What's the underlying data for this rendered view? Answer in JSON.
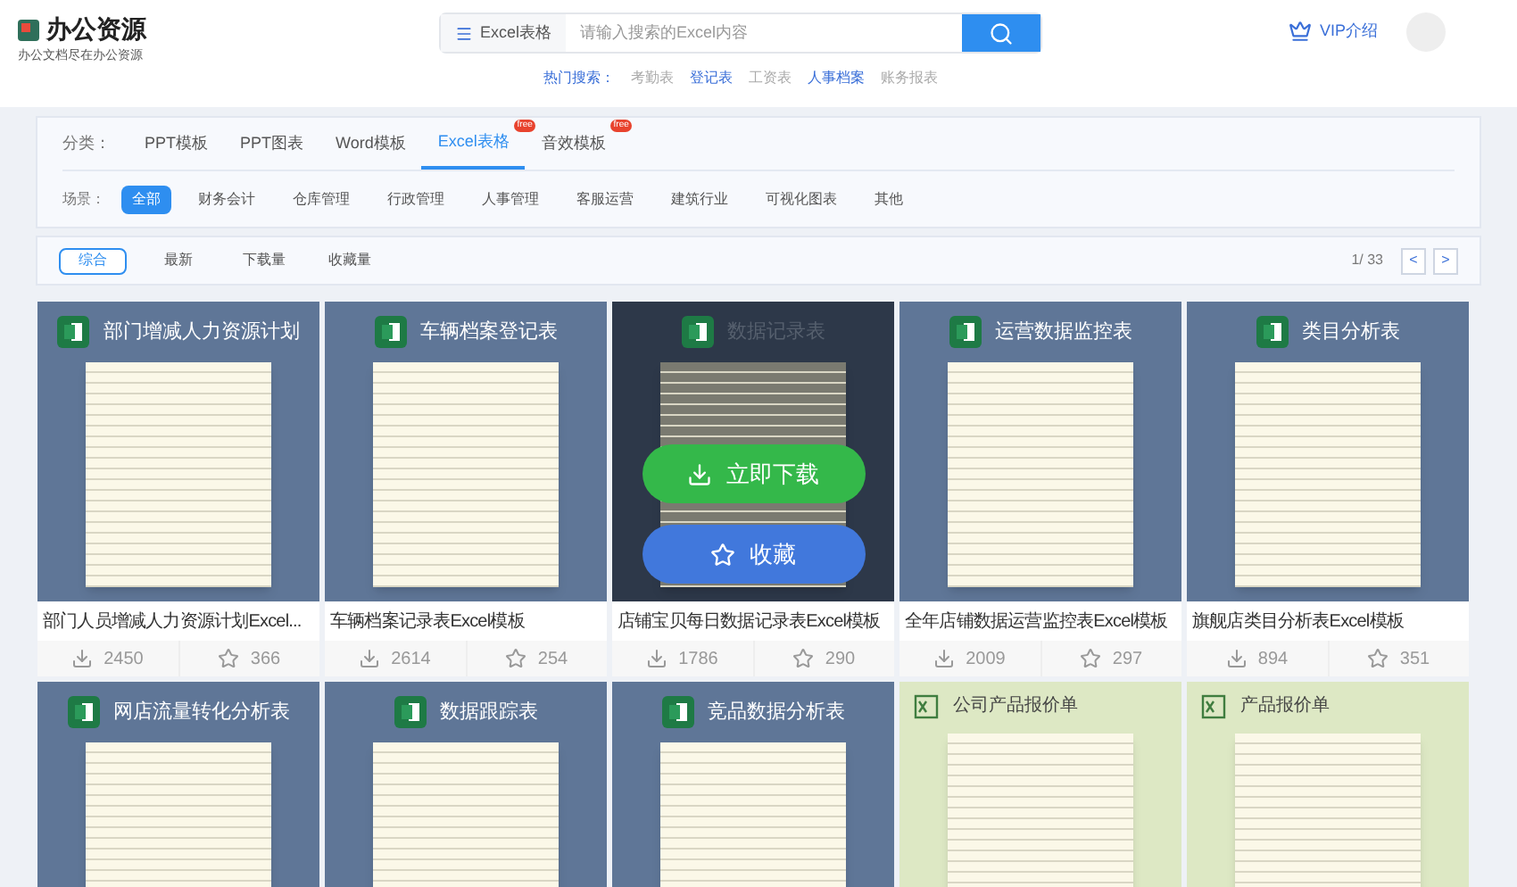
{
  "logo": {
    "name": "办公资源",
    "slogan": "办公文档尽在办公资源"
  },
  "search": {
    "category": "Excel表格",
    "placeholder": "请输入搜索的Excel内容"
  },
  "hot_searches": {
    "label": "热门搜索：",
    "items": [
      {
        "text": "考勤表",
        "highlighted": false
      },
      {
        "text": "登记表",
        "highlighted": true
      },
      {
        "text": "工资表",
        "highlighted": false
      },
      {
        "text": "人事档案",
        "highlighted": true
      },
      {
        "text": "账务报表",
        "highlighted": false
      }
    ]
  },
  "vip": {
    "label": "VIP介绍"
  },
  "categories": {
    "label": "分类：",
    "items": [
      {
        "text": "PPT模板",
        "selected": false
      },
      {
        "text": "PPT图表",
        "selected": false
      },
      {
        "text": "Word模板",
        "selected": false
      },
      {
        "text": "Excel表格",
        "selected": true,
        "badge": "free"
      },
      {
        "text": "音效模板",
        "selected": false,
        "badge": "free"
      }
    ]
  },
  "scenes": {
    "label": "场景：",
    "items": [
      {
        "text": "全部",
        "selected": true
      },
      {
        "text": "财务会计",
        "selected": false
      },
      {
        "text": "仓库管理",
        "selected": false
      },
      {
        "text": "行政管理",
        "selected": false
      },
      {
        "text": "人事管理",
        "selected": false
      },
      {
        "text": "客服运营",
        "selected": false
      },
      {
        "text": "建筑行业",
        "selected": false
      },
      {
        "text": "可视化图表",
        "selected": false
      },
      {
        "text": "其他",
        "selected": false
      }
    ]
  },
  "sort": {
    "items": [
      {
        "text": "综合",
        "selected": true
      },
      {
        "text": "最新",
        "selected": false
      },
      {
        "text": "下载量",
        "selected": false
      },
      {
        "text": "收藏量",
        "selected": false
      }
    ],
    "page": "1/ 33",
    "prev": "<",
    "next": ">"
  },
  "cards": [
    {
      "kind": "blue",
      "banner": "部门增减人力资源计划",
      "title": "部门人员增减人力资源计划Excel...",
      "downloads": "2450",
      "favorites": "366",
      "hovered": false
    },
    {
      "kind": "blue",
      "banner": "车辆档案登记表",
      "title": "车辆档案记录表Excel模板",
      "downloads": "2614",
      "favorites": "254",
      "hovered": false
    },
    {
      "kind": "blue",
      "banner": "数据记录表",
      "title": "店铺宝贝每日数据记录表Excel模板",
      "downloads": "1786",
      "favorites": "290",
      "hovered": true,
      "download_button": "立即下载",
      "favorite_button": "收藏"
    },
    {
      "kind": "blue",
      "banner": "运营数据监控表",
      "title": "全年店铺数据运营监控表Excel模板",
      "downloads": "2009",
      "favorites": "297",
      "hovered": false
    },
    {
      "kind": "blue",
      "banner": "类目分析表",
      "title": "旗舰店类目分析表Excel模板",
      "downloads": "894",
      "favorites": "351",
      "hovered": false
    },
    {
      "kind": "blue",
      "banner": "网店流量转化分析表"
    },
    {
      "kind": "blue",
      "banner": "数据跟踪表"
    },
    {
      "kind": "blue",
      "banner": "竞品数据分析表"
    },
    {
      "kind": "green",
      "banner": "公司产品报价单"
    },
    {
      "kind": "green",
      "banner": "产品报价单"
    }
  ]
}
